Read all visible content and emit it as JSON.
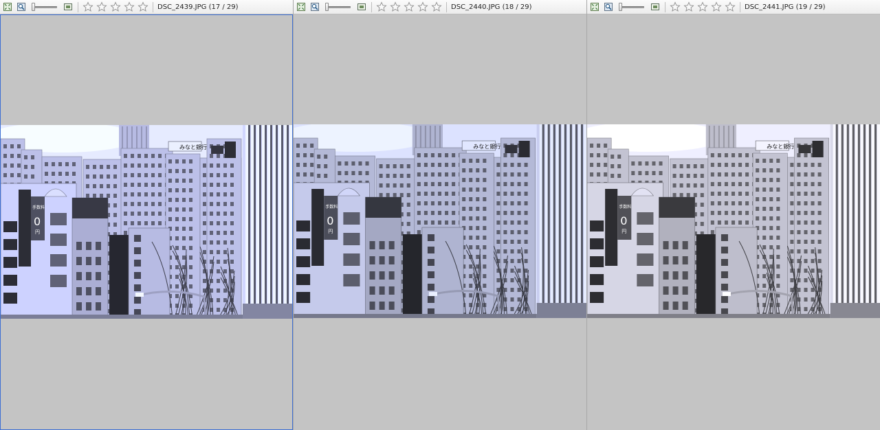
{
  "panes": [
    {
      "filename": "DSC_2439.JPG (17 / 29)",
      "active": true,
      "tint": "#aeb2d8",
      "rating": 0
    },
    {
      "filename": "DSC_2440.JPG (18 / 29)",
      "active": false,
      "tint": "#a7abc7",
      "rating": 0
    },
    {
      "filename": "DSC_2441.JPG (19 / 29)",
      "active": false,
      "tint": "#b5b5c2",
      "rating": 0
    }
  ],
  "icons": {
    "fit": "fit-to-window-icon",
    "zoom": "zoom-icon",
    "slider": "zoom-slider",
    "actual": "actual-size-icon",
    "star": "star-outline-icon"
  },
  "photo_signs": {
    "bank_sign": "みなと銀行",
    "fee_sign": "手数料",
    "zero": "0",
    "yen": "円"
  }
}
